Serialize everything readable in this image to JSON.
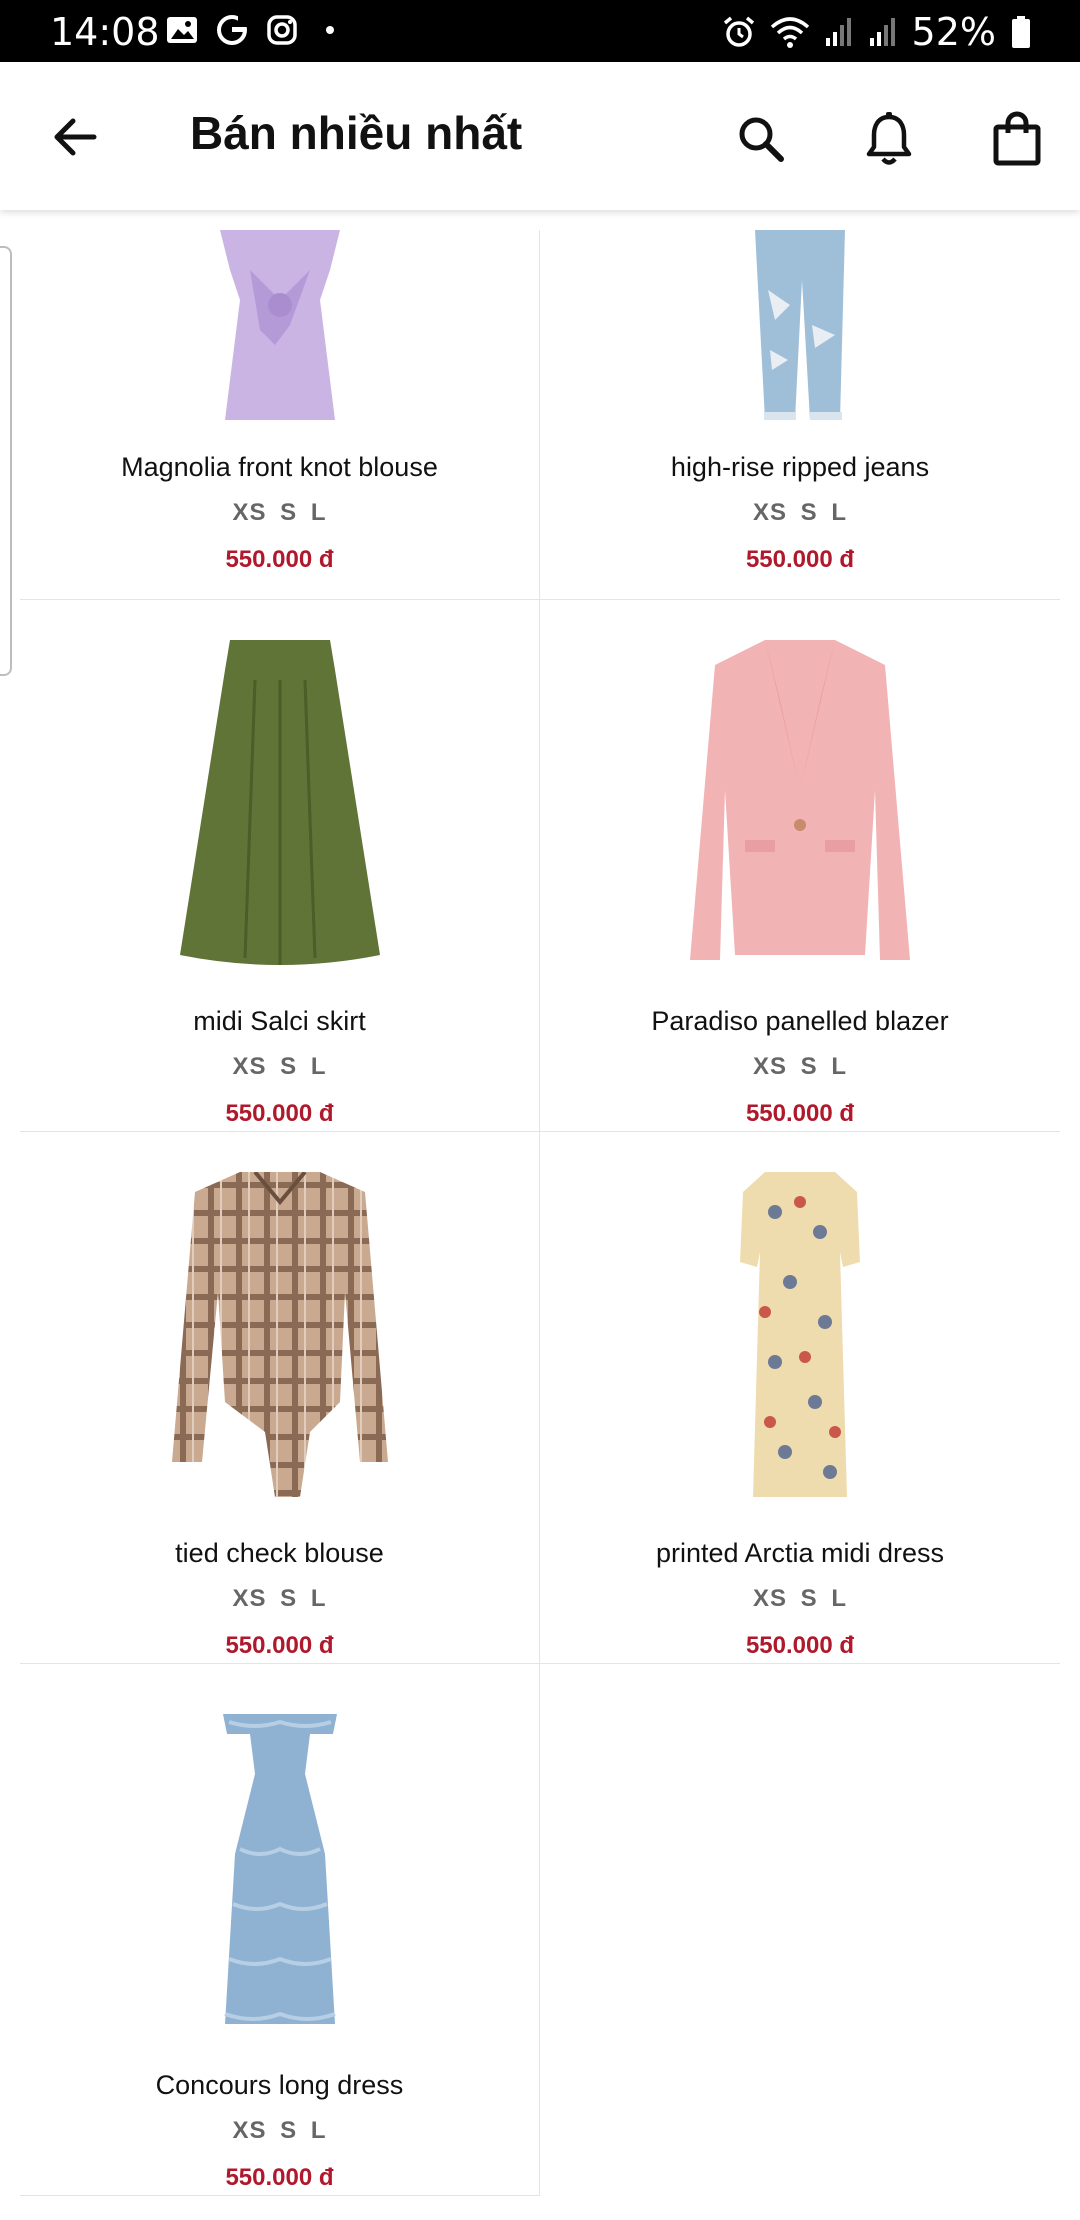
{
  "status_bar": {
    "time": "14:08",
    "battery": "52%",
    "icons_left": [
      "gallery-icon",
      "g-icon",
      "instagram-icon"
    ],
    "icons_right": [
      "alarm-icon",
      "wifi-icon",
      "signal-icon",
      "signal-icon-2",
      "battery-icon"
    ]
  },
  "header": {
    "title": "Bán nhiều nhất",
    "back_icon": "arrow-left-icon",
    "actions": [
      "search-icon",
      "bell-icon",
      "shopping-bag-icon"
    ]
  },
  "products": [
    {
      "name": "Magnolia front knot blouse",
      "sizes": "XS S L",
      "price": "550.000 đ",
      "image": "lavender-blouse"
    },
    {
      "name": "high-rise ripped jeans",
      "sizes": "XS S L",
      "price": "550.000 đ",
      "image": "ripped-jeans"
    },
    {
      "name": "midi Salci skirt",
      "sizes": "XS S L",
      "price": "550.000 đ",
      "image": "olive-skirt"
    },
    {
      "name": "Paradiso panelled blazer",
      "sizes": "XS S L",
      "price": "550.000 đ",
      "image": "pink-blazer"
    },
    {
      "name": "tied check blouse",
      "sizes": "XS S L",
      "price": "550.000 đ",
      "image": "check-blouse"
    },
    {
      "name": "printed Arctia midi dress",
      "sizes": "XS S L",
      "price": "550.000 đ",
      "image": "butterfly-dress"
    },
    {
      "name": "Concours long dress",
      "sizes": "XS S L",
      "price": "550.000 đ",
      "image": "blue-long-dress"
    }
  ],
  "colors": {
    "price": "#b0182c",
    "sizes": "#666666",
    "status_bar_bg": "#000000"
  }
}
